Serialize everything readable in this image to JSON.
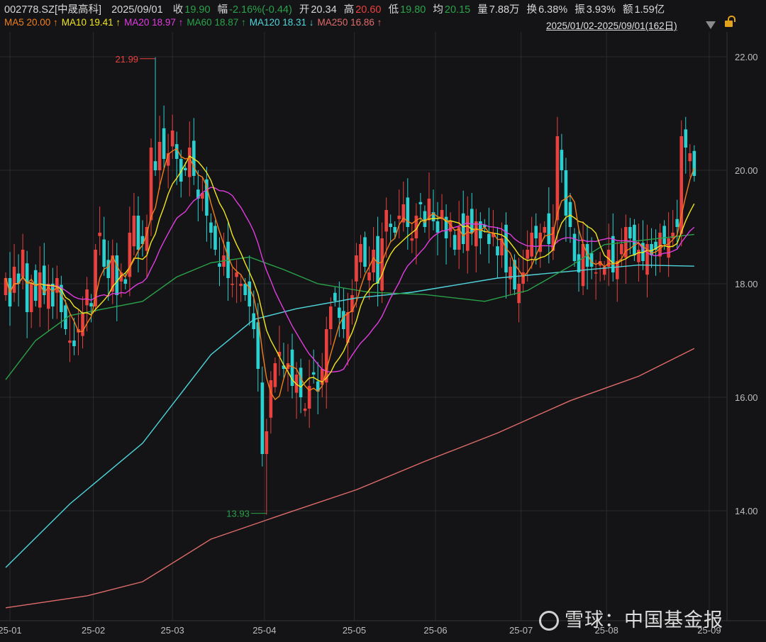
{
  "header": {
    "symbol": "002778.SZ[中晟高科]",
    "date": "2025/09/01",
    "close_label": "收",
    "close": "19.90",
    "change_label": "幅",
    "change": "-2.16%(-0.44)",
    "open_label": "开",
    "open": "20.34",
    "high_label": "高",
    "high": "20.60",
    "low_label": "低",
    "low": "19.80",
    "avg_label": "均",
    "avg": "20.15",
    "vol_label": "量",
    "vol": "7.88万",
    "turnover_label": "换",
    "turnover": "6.38%",
    "amp_label": "振",
    "amp": "3.93%",
    "amount_label": "额",
    "amount": "1.59亿"
  },
  "ma_legend": [
    {
      "label": "MA5 20.00",
      "arrow": "↑",
      "color": "#f07f1a"
    },
    {
      "label": "MA10 19.41",
      "arrow": "↑",
      "color": "#f2e51c"
    },
    {
      "label": "MA20 18.97",
      "arrow": "↑",
      "color": "#e23ce0"
    },
    {
      "label": "MA60 18.87",
      "arrow": "↑",
      "color": "#2aa24a"
    },
    {
      "label": "MA120 18.31",
      "arrow": "↓",
      "color": "#4ed6dd"
    },
    {
      "label": "MA250 16.86",
      "arrow": "↑",
      "color": "#e06b6b"
    }
  ],
  "range_label": "2025/01/02-2025/09/01(162日)",
  "watermark": "雪球：中国基金报",
  "colors": {
    "up": "#e8413e",
    "down": "#2bd1d1",
    "grid": "#2a2a2d",
    "axis_text": "#bdbdbd",
    "high_marker": "#e8413e",
    "low_marker": "#2aa24a"
  },
  "chart_data": {
    "type": "candlestick",
    "ylim": [
      12,
      22.5
    ],
    "yticks": [
      "22.00",
      "20.00",
      "18.00",
      "16.00",
      "14.00"
    ],
    "ytick_values": [
      22,
      20,
      18,
      16,
      14
    ],
    "xticks": [
      {
        "label": "25-01",
        "index": 1
      },
      {
        "label": "25-02",
        "index": 20.5
      },
      {
        "label": "25-03",
        "index": 39
      },
      {
        "label": "25-04",
        "index": 60.5
      },
      {
        "label": "25-05",
        "index": 81.5
      },
      {
        "label": "25-06",
        "index": 100.5
      },
      {
        "label": "25-07",
        "index": 120.5
      },
      {
        "label": "25-08",
        "index": 140.5
      },
      {
        "label": "25-09",
        "index": 164.5
      }
    ],
    "closes": [
      18.1,
      17.6,
      18.3,
      18.0,
      18.6,
      17.5,
      18.0,
      17.7,
      18.2,
      17.8,
      18.0,
      17.6,
      18.1,
      17.5,
      17.2,
      17.0,
      16.9,
      17.2,
      17.5,
      17.9,
      17.6,
      18.6,
      18.9,
      18.3,
      18.1,
      18.5,
      17.8,
      18.2,
      18.0,
      18.9,
      19.2,
      18.6,
      18.7,
      19.0,
      20.4,
      20.0,
      20.5,
      20.2,
      20.3,
      20.7,
      20.2,
      19.8,
      20.0,
      20.4,
      19.9,
      19.5,
      19.6,
      19.2,
      18.9,
      18.6,
      18.3,
      18.5,
      18.1,
      18.0,
      18.2,
      18.0,
      17.8,
      17.6,
      17.2,
      16.5,
      15.0,
      15.4,
      16.3,
      16.6,
      16.8,
      16.5,
      16.6,
      16.2,
      16.4,
      16.0,
      15.8,
      16.2,
      16.4,
      16.1,
      16.5,
      17.2,
      17.6,
      17.7,
      17.4,
      17.2,
      17.5,
      17.8,
      18.5,
      18.7,
      18.3,
      18.2,
      18.6,
      18.0,
      18.8,
      19.3,
      19.0,
      18.9,
      19.2,
      19.4,
      19.0,
      18.8,
      19.2,
      19.4,
      19.0,
      19.5,
      19.1,
      18.9,
      19.3,
      18.8,
      19.1,
      18.6,
      19.0,
      18.7,
      19.2,
      18.9,
      19.1,
      18.8,
      19.0,
      18.7,
      18.9,
      18.5,
      18.8,
      18.2,
      18.3,
      17.9,
      18.0,
      18.2,
      18.6,
      18.9,
      18.8,
      18.9,
      19.0,
      18.7,
      19.0,
      20.6,
      20.0,
      19.2,
      19.0,
      18.4,
      18.2,
      18.7,
      18.3,
      18.3,
      18.2,
      18.4,
      18.3,
      18.6,
      18.2,
      18.4,
      18.7,
      19.0,
      18.8,
      18.5,
      18.6,
      18.4,
      18.7,
      18.5,
      18.6,
      18.9,
      18.7,
      18.8,
      18.9,
      19.0,
      20.6,
      20.4,
      20.3,
      19.9
    ],
    "last_open": 20.34,
    "extremes": {
      "high": {
        "index": 35,
        "value": 21.99,
        "label": "21.99"
      },
      "low": {
        "index": 61,
        "value": 13.93,
        "label": "13.93"
      }
    },
    "ma60": [
      [
        0,
        16.31
      ],
      [
        7,
        17.0
      ],
      [
        15,
        17.44
      ],
      [
        32,
        17.69
      ],
      [
        40,
        18.12
      ],
      [
        48,
        18.37
      ],
      [
        57,
        18.47
      ],
      [
        65,
        18.25
      ],
      [
        73,
        18.0
      ],
      [
        85,
        17.85
      ],
      [
        98,
        17.81
      ],
      [
        112,
        17.69
      ],
      [
        122,
        17.88
      ],
      [
        132,
        18.31
      ],
      [
        140,
        18.69
      ],
      [
        161,
        18.87
      ]
    ],
    "ma120": [
      [
        0,
        13.0
      ],
      [
        15,
        14.12
      ],
      [
        32,
        15.19
      ],
      [
        48,
        16.75
      ],
      [
        58,
        17.37
      ],
      [
        68,
        17.56
      ],
      [
        82,
        17.75
      ],
      [
        95,
        17.85
      ],
      [
        115,
        18.1
      ],
      [
        132,
        18.22
      ],
      [
        148,
        18.33
      ],
      [
        161,
        18.31
      ]
    ],
    "ma250": [
      [
        0,
        12.29
      ],
      [
        19,
        12.5
      ],
      [
        32,
        12.75
      ],
      [
        48,
        13.5
      ],
      [
        65,
        13.94
      ],
      [
        82,
        14.37
      ],
      [
        98,
        14.87
      ],
      [
        115,
        15.37
      ],
      [
        132,
        15.94
      ],
      [
        148,
        16.37
      ],
      [
        161,
        16.86
      ]
    ]
  }
}
